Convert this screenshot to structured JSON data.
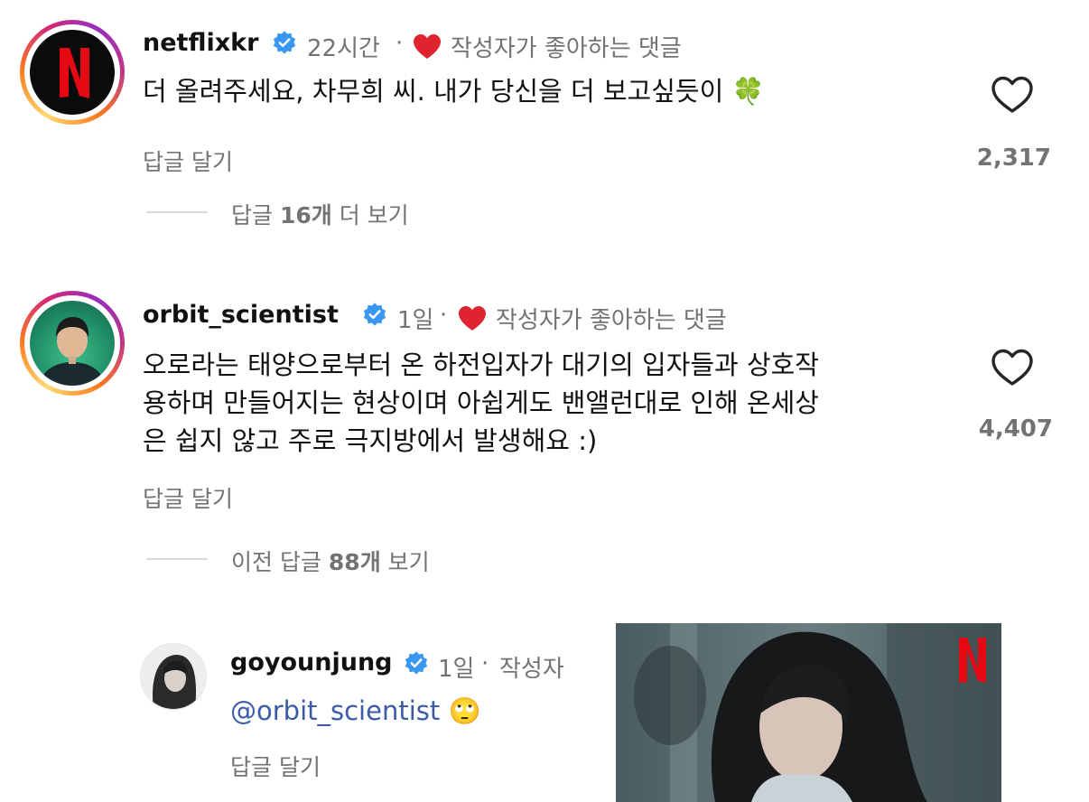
{
  "comments": [
    {
      "username": "netflixkr",
      "time": "22시간",
      "liked_by_author": "작성자가 좋아하는 댓글",
      "text": "더 올려주세요, 차무희 씨. 내가 당신을 더 보고싶듯이",
      "emoji": "🍀",
      "reply_label": "답글 달기",
      "like_count": "2,317",
      "view_replies": {
        "prefix": "답글 ",
        "count": "16개",
        "suffix": " 더 보기"
      }
    },
    {
      "username": "orbit_scientist",
      "time": "1일",
      "liked_by_author": "작성자가 좋아하는 댓글",
      "text_lines": [
        "오로라는 태양으로부터 온 하전입자가 대기의 입자들과 상호작",
        "용하며 만들어지는 현상이며 아쉽게도 밴앨런대로 인해 온세상",
        "은 쉽지 않고 주로 극지방에서 발생해요 :)"
      ],
      "reply_label": "답글 달기",
      "like_count": "4,407",
      "view_replies": {
        "prefix": "이전 답글 ",
        "count": "88개",
        "suffix": " 보기"
      }
    }
  ],
  "reply": {
    "username": "goyounjung",
    "time": "1일",
    "author_label": "작성자",
    "mention": "@orbit_scientist",
    "emoji": "🙄",
    "reply_label": "답글 달기"
  },
  "separator": "·",
  "colors": {
    "meta": "#737373",
    "mention": "#3b5ba8",
    "heart": "#e0242f",
    "verified": "#3897f0"
  },
  "icons": [
    "netflix-logo",
    "verified-badge-icon",
    "heart-filled-icon",
    "heart-outline-icon"
  ]
}
